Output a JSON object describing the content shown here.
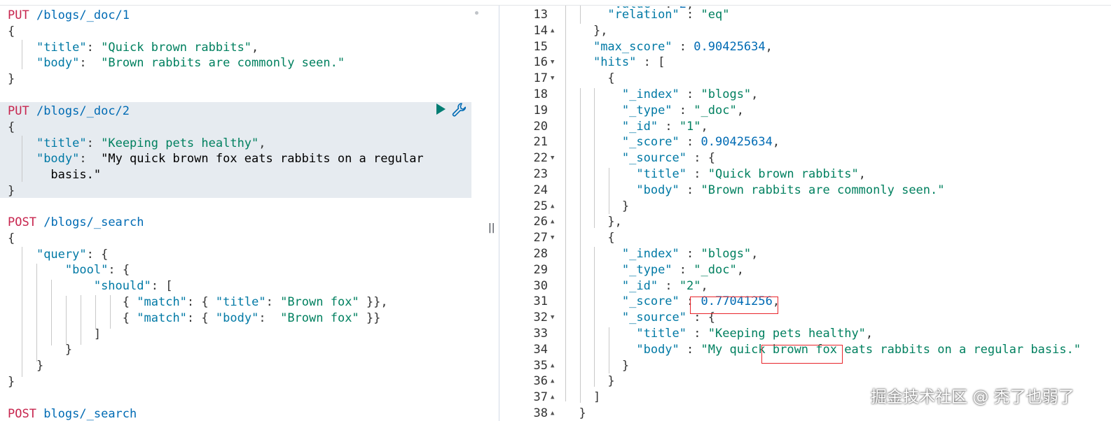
{
  "request_editor": {
    "requests": [
      {
        "method": "PUT",
        "path": "/blogs/_doc/1",
        "body_lines": [
          "{",
          "    \"title\": \"Quick brown rabbits\",",
          "    \"body\":  \"Brown rabbits are commonly seen.\"",
          "}"
        ]
      },
      {
        "method": "PUT",
        "path": "/blogs/_doc/2",
        "active": true,
        "body_lines": [
          "{",
          "    \"title\": \"Keeping pets healthy\",",
          "    \"body\":  \"My quick brown fox eats rabbits on a regular",
          "      basis.\"",
          "}"
        ]
      },
      {
        "method": "POST",
        "path": "/blogs/_search",
        "body_lines": [
          "{",
          "    \"query\": {",
          "        \"bool\": {",
          "            \"should\": [",
          "                { \"match\": { \"title\": \"Brown fox\" }},",
          "                { \"match\": { \"body\":  \"Brown fox\" }}",
          "            ]",
          "        }",
          "    }",
          "}"
        ]
      },
      {
        "method": "POST",
        "path": "blogs/_search",
        "body_lines": []
      }
    ],
    "run_icon": "play-icon",
    "settings_icon": "wrench-icon"
  },
  "divider_handle": "||",
  "response_panel": {
    "lines": [
      {
        "n": "13",
        "fold": "",
        "text": "      \"relation\" : \"eq\""
      },
      {
        "n": "14",
        "fold": "▲",
        "text": "    },"
      },
      {
        "n": "15",
        "fold": "",
        "text": "    \"max_score\" : 0.90425634,"
      },
      {
        "n": "16",
        "fold": "▼",
        "text": "    \"hits\" : ["
      },
      {
        "n": "17",
        "fold": "▼",
        "text": "      {"
      },
      {
        "n": "18",
        "fold": "",
        "text": "        \"_index\" : \"blogs\","
      },
      {
        "n": "19",
        "fold": "",
        "text": "        \"_type\" : \"_doc\","
      },
      {
        "n": "20",
        "fold": "",
        "text": "        \"_id\" : \"1\","
      },
      {
        "n": "21",
        "fold": "",
        "text": "        \"_score\" : 0.90425634,"
      },
      {
        "n": "22",
        "fold": "▼",
        "text": "        \"_source\" : {"
      },
      {
        "n": "23",
        "fold": "",
        "text": "          \"title\" : \"Quick brown rabbits\","
      },
      {
        "n": "24",
        "fold": "",
        "text": "          \"body\" : \"Brown rabbits are commonly seen.\""
      },
      {
        "n": "25",
        "fold": "▲",
        "text": "        }"
      },
      {
        "n": "26",
        "fold": "▲",
        "text": "      },"
      },
      {
        "n": "27",
        "fold": "▼",
        "text": "      {"
      },
      {
        "n": "28",
        "fold": "",
        "text": "        \"_index\" : \"blogs\","
      },
      {
        "n": "29",
        "fold": "",
        "text": "        \"_type\" : \"_doc\","
      },
      {
        "n": "30",
        "fold": "",
        "text": "        \"_id\" : \"2\","
      },
      {
        "n": "31",
        "fold": "",
        "text": "        \"_score\" : 0.77041256,"
      },
      {
        "n": "32",
        "fold": "▼",
        "text": "        \"_source\" : {"
      },
      {
        "n": "33",
        "fold": "",
        "text": "          \"title\" : \"Keeping pets healthy\","
      },
      {
        "n": "34",
        "fold": "",
        "text": "          \"body\" : \"My quick brown fox eats rabbits on a regular basis.\""
      },
      {
        "n": "35",
        "fold": "▲",
        "text": "        }"
      },
      {
        "n": "36",
        "fold": "▲",
        "text": "      }"
      },
      {
        "n": "37",
        "fold": "▲",
        "text": "    ]"
      },
      {
        "n": "38",
        "fold": "▲",
        "text": "  }"
      }
    ],
    "highlights": [
      "0.77041256,",
      "brown fox e"
    ]
  },
  "watermark": "掘金技术社区 @ 秃了也弱了",
  "colors": {
    "method": "#c7254e",
    "path": "#006bb4",
    "key": "#0079a5",
    "string": "#00805f",
    "number": "#006bb4",
    "highlight_box": "#e8252b",
    "active_request_bg": "#e6ebf0",
    "run_button": "#017d73"
  }
}
